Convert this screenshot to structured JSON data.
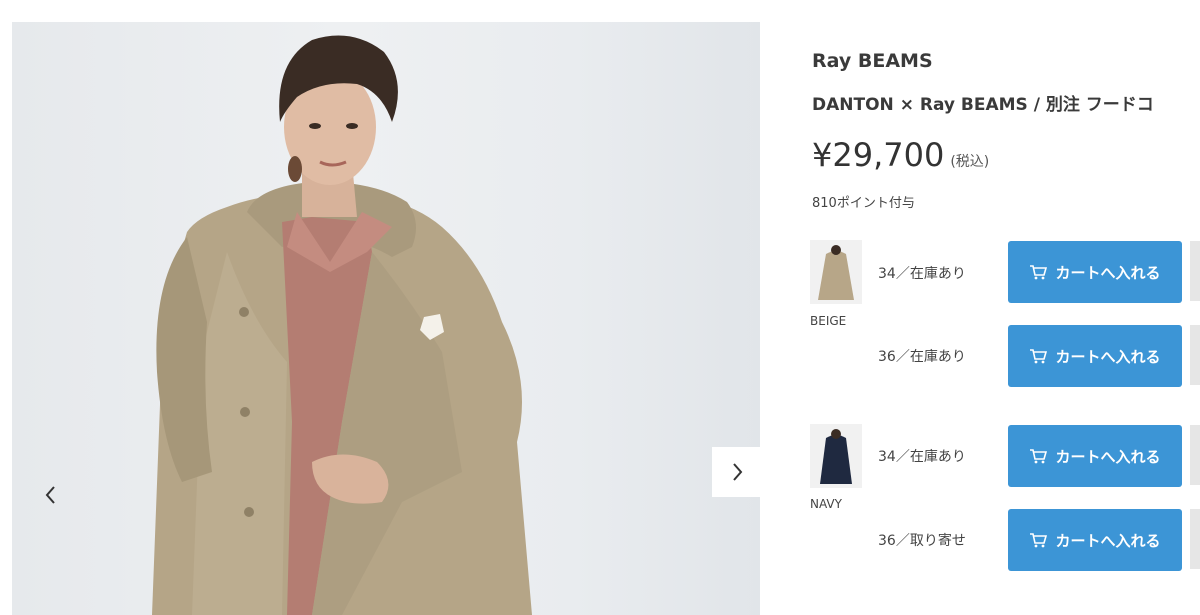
{
  "gallery": {
    "prev_icon": "chevron-left-icon",
    "next_icon": "chevron-right-icon"
  },
  "product": {
    "brand": "Ray BEAMS",
    "name": "DANTON × Ray BEAMS / 別注 フードコ",
    "price": "¥29,700",
    "tax_note": "(税込)",
    "points": "810ポイント付与"
  },
  "variants": [
    {
      "color": "BEIGE",
      "thumb_color": "#b7a688",
      "sizes": [
        {
          "label": "34／在庫あり",
          "button": "カートへ入れる"
        },
        {
          "label": "36／在庫あり",
          "button": "カートへ入れる"
        }
      ]
    },
    {
      "color": "NAVY",
      "thumb_color": "#1f2940",
      "sizes": [
        {
          "label": "34／在庫あり",
          "button": "カートへ入れる"
        },
        {
          "label": "36／取り寄せ",
          "button": "カートへ入れる"
        }
      ]
    }
  ],
  "colors": {
    "cart_button": "#3c95d6",
    "coat": "#b5a587",
    "shirt": "#b47d72"
  }
}
